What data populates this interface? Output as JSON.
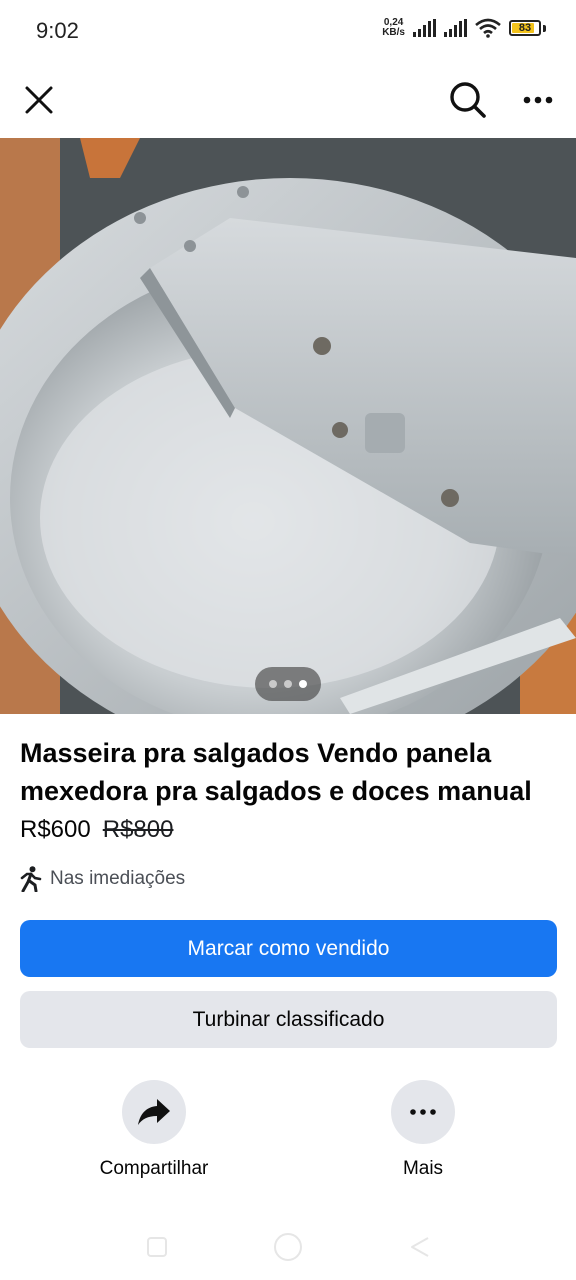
{
  "status_bar": {
    "time": "9:02",
    "net_speed_value": "0,24",
    "net_speed_unit": "KB/s",
    "battery": "83",
    "battery_level": 0.83,
    "battery_color": "#f2c21b",
    "icons": [
      "signal-icon",
      "signal-icon",
      "wifi-icon",
      "battery-icon"
    ]
  },
  "top_nav": {
    "close_icon": "close-icon",
    "search_icon": "search-icon",
    "more_icon": "more-horizontal-icon"
  },
  "gallery": {
    "pages": 3,
    "current_page": 3
  },
  "listing": {
    "title": "Masseira pra salgados Vendo panela mexedora pra salgados e doces manual",
    "price": "R$600",
    "old_price": "R$800",
    "location": "Nas imediações"
  },
  "buttons": {
    "mark_sold": "Marcar como vendido",
    "boost": "Turbinar classificado"
  },
  "actions": {
    "share": "Compartilhar",
    "more": "Mais"
  },
  "colors": {
    "primary": "#1877f2",
    "secondary_bg": "#e4e6eb"
  }
}
